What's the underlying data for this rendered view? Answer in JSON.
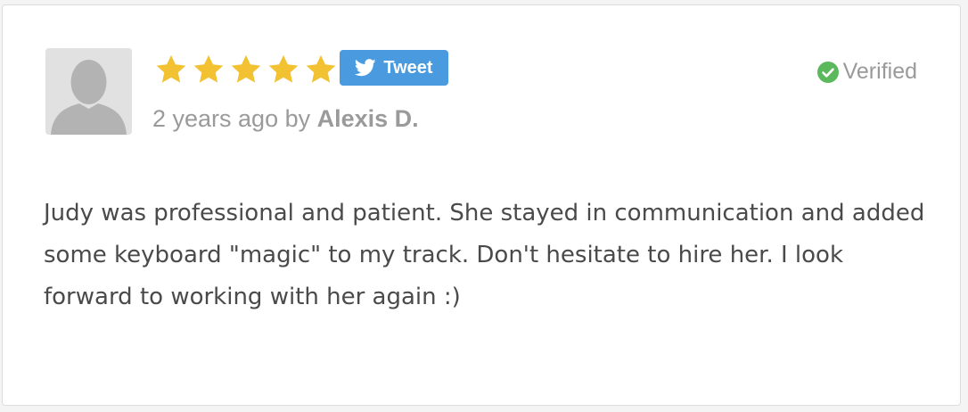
{
  "review": {
    "rating": 5,
    "max_rating": 5,
    "tweet_label": "Tweet",
    "time_prefix": "2 years ago by",
    "author": "Alexis D.",
    "verified_label": "Verified",
    "text": "Judy was professional and patient. She stayed in communication and added some keyboard \"magic\" to my track. Don't hesitate to hire her. I look forward to working with her again :)"
  },
  "icons": {
    "avatar": "default-user-silhouette-icon",
    "star": "star-icon",
    "tweet": "twitter-bird-icon",
    "verified": "check-circle-icon"
  },
  "colors": {
    "star": "#f2c233",
    "tweet_button": "#4a9ae0",
    "verified_check": "#5cb85c",
    "muted_text": "#9a9a9a",
    "body_text": "#4a4a4a"
  }
}
